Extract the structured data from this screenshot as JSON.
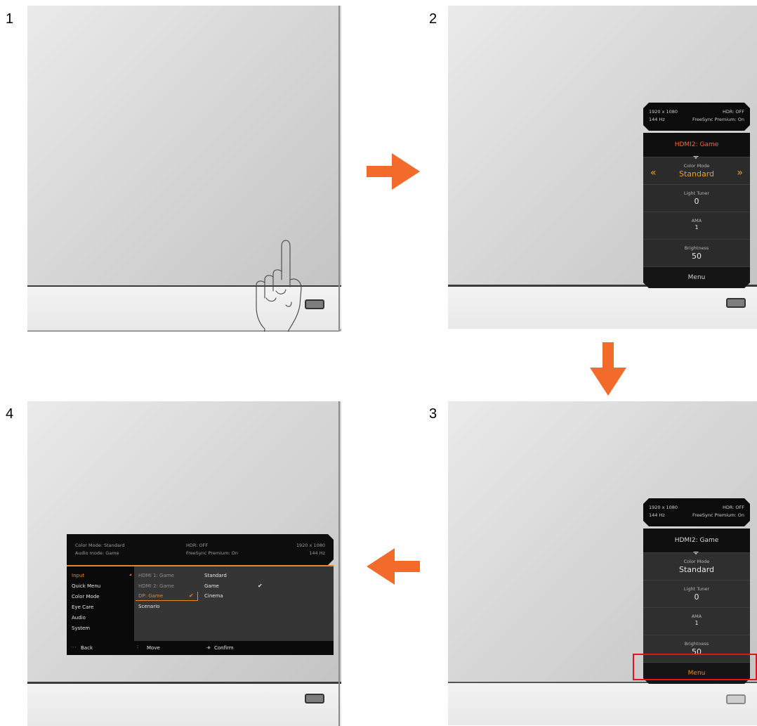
{
  "steps": [
    "1",
    "2",
    "3",
    "4"
  ],
  "quick_osd": {
    "resolution": "1920 x 1080",
    "refresh": "144 Hz",
    "hdr": "HDR: OFF",
    "freesync": "FreeSync Premium: On",
    "input": "HDMI2: Game",
    "items": [
      {
        "label": "Color Mode",
        "value": "Standard"
      },
      {
        "label": "Light Tuner",
        "value": "0"
      },
      {
        "label": "AMA",
        "value": "1"
      },
      {
        "label": "Brightness",
        "value": "50"
      }
    ],
    "menu_label": "Menu",
    "chevron_left": "«",
    "chevron_right": "»"
  },
  "main_osd": {
    "color_mode": "Color Mode: Standard",
    "audio_mode": "Audio mode: Game",
    "hdr": "HDR: OFF",
    "freesync": "FreeSync Premium: On",
    "resolution": "1920 x 1080",
    "refresh": "144 Hz",
    "sidebar": [
      "Input",
      "Quick Menu",
      "Color Mode",
      "Eye Care",
      "Audio",
      "System"
    ],
    "inputs": [
      "HDMI 1: Game",
      "HDMI 2: Game",
      "DP: Game",
      "Scenario"
    ],
    "modes": [
      "Standard",
      "Game",
      "Cinema"
    ],
    "footer": {
      "back": "Back",
      "move": "Move",
      "confirm": "Confirm"
    }
  },
  "colors": {
    "arrow": "#f26b2b",
    "highlight": "#e8871e",
    "callout": "#e2131b"
  }
}
